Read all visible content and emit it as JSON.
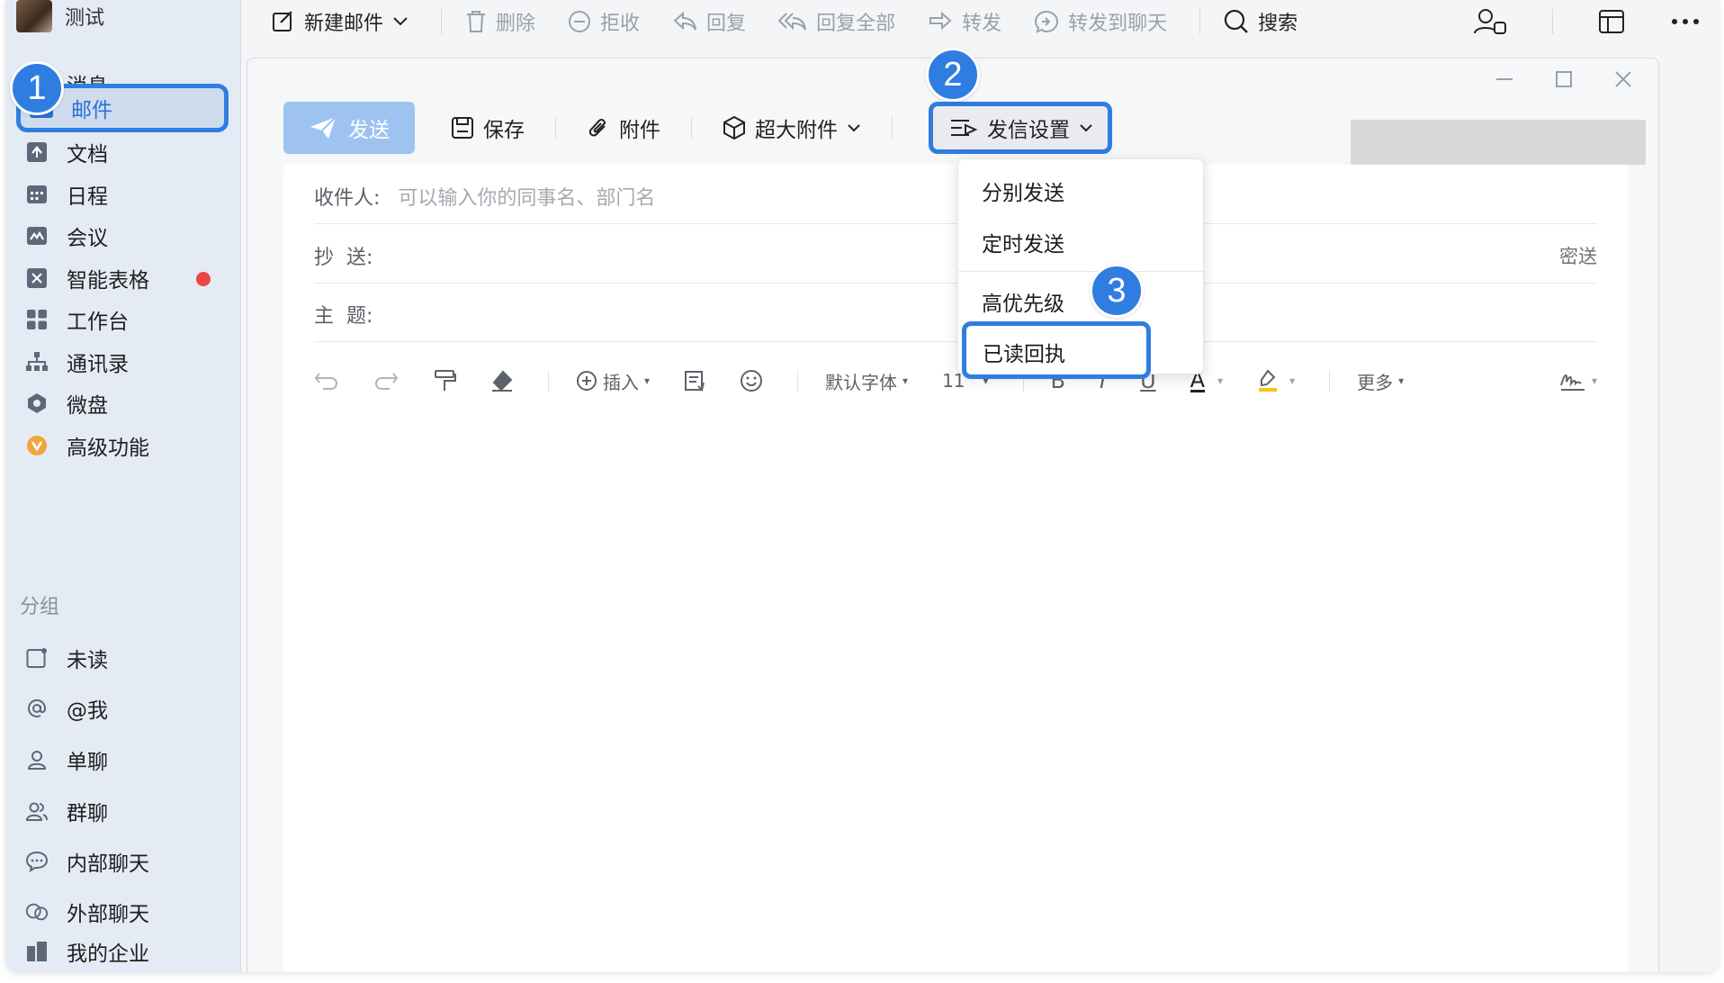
{
  "sidebar": {
    "user_name": "测试",
    "items": [
      {
        "label": "消息",
        "icon": "message-icon"
      },
      {
        "label": "邮件",
        "icon": "mail-icon"
      },
      {
        "label": "文档",
        "icon": "document-icon"
      },
      {
        "label": "日程",
        "icon": "calendar-icon"
      },
      {
        "label": "会议",
        "icon": "meeting-icon"
      },
      {
        "label": "智能表格",
        "icon": "smart-table-icon"
      },
      {
        "label": "工作台",
        "icon": "workbench-icon"
      },
      {
        "label": "通讯录",
        "icon": "contacts-icon"
      },
      {
        "label": "微盘",
        "icon": "drive-icon"
      },
      {
        "label": "高级功能",
        "icon": "advanced-icon"
      }
    ],
    "group_label": "分组",
    "groups": [
      {
        "label": "未读",
        "icon": "unread-icon"
      },
      {
        "label": "@我",
        "icon": "mention-icon"
      },
      {
        "label": "单聊",
        "icon": "single-chat-icon"
      },
      {
        "label": "群聊",
        "icon": "group-chat-icon"
      },
      {
        "label": "内部聊天",
        "icon": "internal-chat-icon"
      },
      {
        "label": "外部聊天",
        "icon": "external-chat-icon"
      },
      {
        "label": "我的企业",
        "icon": "enterprise-icon"
      }
    ]
  },
  "toolbar": {
    "new_mail": "新建邮件",
    "delete": "删除",
    "reject": "拒收",
    "reply": "回复",
    "reply_all": "回复全部",
    "forward": "转发",
    "forward_chat": "转发到聊天",
    "search": "搜索"
  },
  "compose": {
    "send": "发送",
    "save": "保存",
    "attach": "附件",
    "big_attach": "超大附件",
    "send_settings": "发信设置",
    "to_label": "收件人:",
    "to_placeholder": "可以输入你的同事名、部门名",
    "cc_label": "抄  送:",
    "bcc": "密送",
    "subject_label": "主  题:",
    "format": {
      "insert": "插入",
      "font": "默认字体",
      "size": "11",
      "bold": "B",
      "italic": "I",
      "underline": "U",
      "color": "A",
      "more": "更多"
    }
  },
  "dropdown": {
    "items": [
      "分别发送",
      "定时发送",
      "高优先级",
      "已读回执"
    ]
  },
  "markers": [
    "1",
    "2",
    "3"
  ],
  "colors": {
    "accent": "#2f7de1",
    "send_button": "#9ec3f1",
    "badge": "#ef4444"
  }
}
